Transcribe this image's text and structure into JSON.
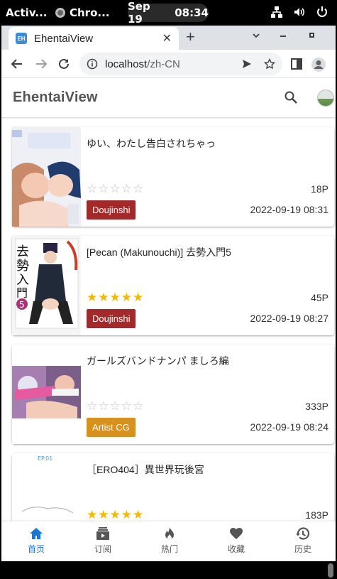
{
  "system_bar": {
    "activities": "Activ...",
    "app_name": "Chro...",
    "date": "Sep 19",
    "time": "08:34"
  },
  "browser": {
    "tab_title": "EhentaiView",
    "tab_favicon": "EH",
    "url_host": "localhost",
    "url_path": "/zh-CN"
  },
  "app": {
    "title": "EhentaiView",
    "cards": [
      {
        "title": "ゆい、わたし告白されちゃっ",
        "rating": 0,
        "stars": "☆☆☆☆☆",
        "pages": "18P",
        "category": "Doujinshi",
        "category_color": "#a32a2a",
        "date": "2022-09-19 08:31"
      },
      {
        "title": "[Pecan (Makunouchi)] 去勢入門5",
        "rating": 5,
        "stars": "★★★★★",
        "pages": "45P",
        "category": "Doujinshi",
        "category_color": "#a32a2a",
        "date": "2022-09-19 08:27"
      },
      {
        "title": "ガールズバンドナンパ ましろ編",
        "rating": 0,
        "stars": "☆☆☆☆☆",
        "pages": "333P",
        "category": "Artist CG",
        "category_color": "#d8911f",
        "date": "2022-09-19 08:24"
      },
      {
        "title": "［ERO404］異世界玩後宮",
        "rating": 5,
        "stars": "★★★★★",
        "pages": "183P",
        "category": "",
        "category_color": "",
        "date": ""
      }
    ],
    "nav": [
      {
        "label": "首页",
        "icon": "home-icon",
        "active": true
      },
      {
        "label": "订阅",
        "icon": "subscriptions-icon",
        "active": false
      },
      {
        "label": "热门",
        "icon": "fire-icon",
        "active": false
      },
      {
        "label": "收藏",
        "icon": "heart-icon",
        "active": false
      },
      {
        "label": "历史",
        "icon": "history-icon",
        "active": false
      }
    ]
  },
  "colors": {
    "accent": "#1976d2",
    "star": "#f5b800",
    "doujinshi": "#a32a2a",
    "artist_cg": "#d8911f"
  }
}
